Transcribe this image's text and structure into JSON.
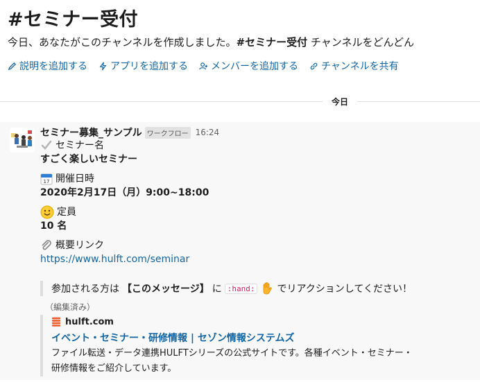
{
  "channel": {
    "title": "#セミナー受付",
    "intro_prefix": "今日、あなたがこのチャンネルを作成しました。",
    "intro_bold": "#セミナー受付",
    "intro_suffix": " チャンネルをどんどん"
  },
  "actions": [
    {
      "label": "説明を追加する",
      "icon": "pencil-icon"
    },
    {
      "label": "アプリを追加する",
      "icon": "lightning-icon"
    },
    {
      "label": "メンバーを追加する",
      "icon": "add-person-icon"
    },
    {
      "label": "チャンネルを共有",
      "icon": "link-icon"
    }
  ],
  "day_divider": "今日",
  "message": {
    "sender": "セミナー募集_サンプル",
    "badge": "ワークフロー",
    "time": "16:24",
    "fields": [
      {
        "icon": "check-icon",
        "label": "セミナー名",
        "value": "すごく楽しいセミナー"
      },
      {
        "icon": "calendar-icon",
        "label": "開催日時",
        "value": "2020年2月17日（月）9:00~18:00"
      },
      {
        "icon": "smile-icon",
        "label": "定員",
        "value": "10 名"
      },
      {
        "icon": "paperclip-icon",
        "label": "概要リンク",
        "value": "https://www.hulft.com/seminar"
      }
    ],
    "quote": {
      "prefix": "参加される方は",
      "bold": "【このメッセージ】",
      "middle": "に",
      "code": ":hand:",
      "suffix": "でリアクションしてください！"
    },
    "edited": "（編集済み）",
    "unfurl": {
      "site": "hulft.com",
      "title": "イベント・セミナー・研修情報 | セゾン情報システムズ",
      "desc_line1": "ファイル転送・データ連携HULFTシリーズの公式サイトです。各種イベント・セミナー・",
      "desc_line2": "研修情報をご紹介しています。"
    }
  },
  "colors": {
    "link": "#1264a3",
    "code": "#e01e5a",
    "divider": "#dddddd"
  }
}
